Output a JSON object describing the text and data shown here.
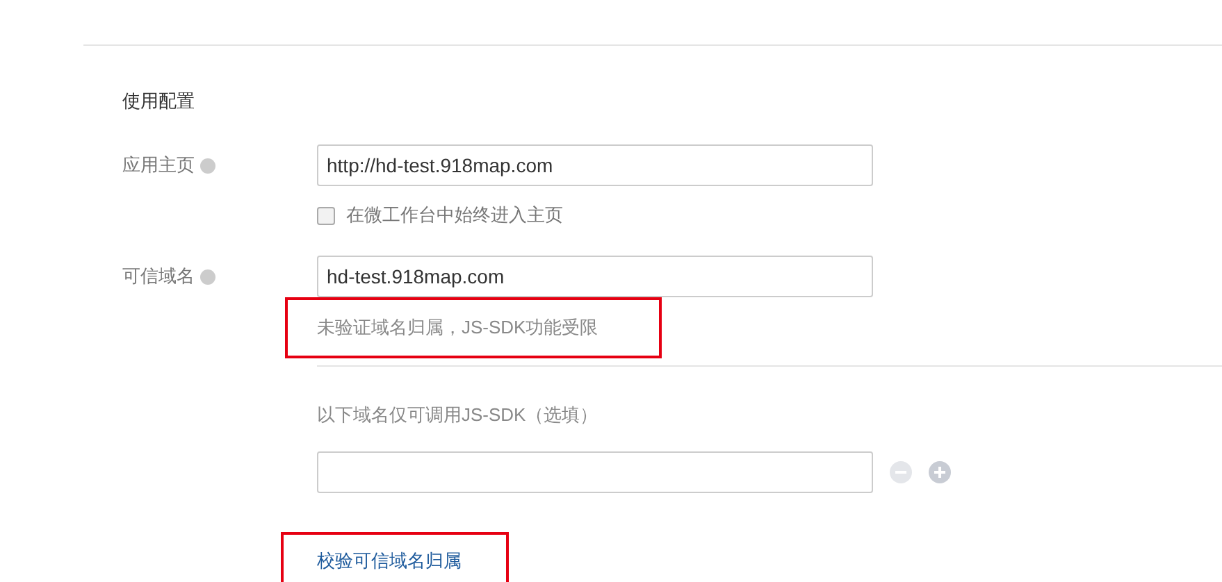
{
  "section_title": "使用配置",
  "home_page": {
    "label": "应用主页",
    "value": "http://hd-test.918map.com",
    "checkbox": {
      "label": "在微工作台中始终进入主页",
      "checked": false
    }
  },
  "trusted_domain": {
    "label": "可信域名",
    "value": "hd-test.918map.com",
    "warning": {
      "text": "未验证域名归属，JS-SDK功能受限",
      "highlighted": true
    }
  },
  "sdk_domains": {
    "label": "以下域名仅可调用JS-SDK（选填）",
    "remove_disabled": true
  },
  "verify_link": {
    "text": "校验可信域名归属",
    "highlighted": true
  }
}
